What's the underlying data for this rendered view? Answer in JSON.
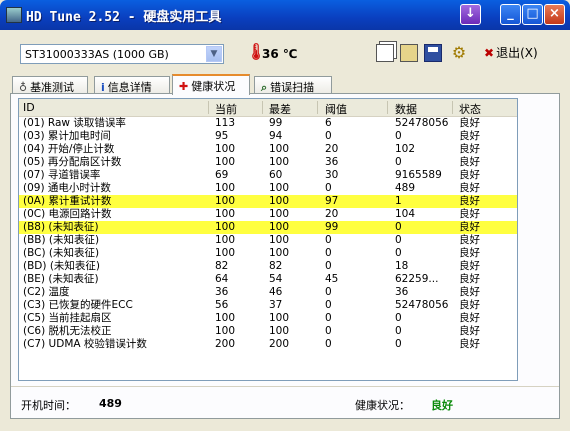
{
  "window": {
    "title": "HD Tune 2.52 - 硬盘实用工具"
  },
  "toolbar": {
    "drive": "ST31000333AS (1000 GB)",
    "temperature": "36 ℃",
    "exit_label": "退出(X)"
  },
  "tabs": [
    {
      "label": "基准测试",
      "icon": "gauge-icon"
    },
    {
      "label": "信息详情",
      "icon": "info-icon"
    },
    {
      "label": "健康状况",
      "icon": "red-cross-icon",
      "active": true
    },
    {
      "label": "错误扫描",
      "icon": "magnifier-icon"
    }
  ],
  "table": {
    "columns": [
      "ID",
      "当前",
      "最差",
      "阈值",
      "数据",
      "状态"
    ],
    "rows": [
      {
        "id": "(01) Raw 读取错误率",
        "current": "113",
        "worst": "99",
        "threshold": "6",
        "data": "52478056",
        "status": "良好",
        "highlight": false
      },
      {
        "id": "(03) 累计加电时间",
        "current": "95",
        "worst": "94",
        "threshold": "0",
        "data": "0",
        "status": "良好",
        "highlight": false
      },
      {
        "id": "(04) 开始/停止计数",
        "current": "100",
        "worst": "100",
        "threshold": "20",
        "data": "102",
        "status": "良好",
        "highlight": false
      },
      {
        "id": "(05) 再分配扇区计数",
        "current": "100",
        "worst": "100",
        "threshold": "36",
        "data": "0",
        "status": "良好",
        "highlight": false
      },
      {
        "id": "(07) 寻道错误率",
        "current": "69",
        "worst": "60",
        "threshold": "30",
        "data": "9165589",
        "status": "良好",
        "highlight": false
      },
      {
        "id": "(09) 通电小时计数",
        "current": "100",
        "worst": "100",
        "threshold": "0",
        "data": "489",
        "status": "良好",
        "highlight": false
      },
      {
        "id": "(0A) 累计重试计数",
        "current": "100",
        "worst": "100",
        "threshold": "97",
        "data": "1",
        "status": "良好",
        "highlight": true
      },
      {
        "id": "(0C) 电源回路计数",
        "current": "100",
        "worst": "100",
        "threshold": "20",
        "data": "104",
        "status": "良好",
        "highlight": false
      },
      {
        "id": "(B8) (未知表征)",
        "current": "100",
        "worst": "100",
        "threshold": "99",
        "data": "0",
        "status": "良好",
        "highlight": true
      },
      {
        "id": "(BB) (未知表征)",
        "current": "100",
        "worst": "100",
        "threshold": "0",
        "data": "0",
        "status": "良好",
        "highlight": false
      },
      {
        "id": "(BC) (未知表征)",
        "current": "100",
        "worst": "100",
        "threshold": "0",
        "data": "0",
        "status": "良好",
        "highlight": false
      },
      {
        "id": "(BD) (未知表征)",
        "current": "82",
        "worst": "82",
        "threshold": "0",
        "data": "18",
        "status": "良好",
        "highlight": false
      },
      {
        "id": "(BE) (未知表征)",
        "current": "64",
        "worst": "54",
        "threshold": "45",
        "data": "62259...",
        "status": "良好",
        "highlight": false
      },
      {
        "id": "(C2) 温度",
        "current": "36",
        "worst": "46",
        "threshold": "0",
        "data": "36",
        "status": "良好",
        "highlight": false
      },
      {
        "id": "(C3) 已恢复的硬件ECC",
        "current": "56",
        "worst": "37",
        "threshold": "0",
        "data": "52478056",
        "status": "良好",
        "highlight": false
      },
      {
        "id": "(C5) 当前挂起扇区",
        "current": "100",
        "worst": "100",
        "threshold": "0",
        "data": "0",
        "status": "良好",
        "highlight": false
      },
      {
        "id": "(C6) 脱机无法校正",
        "current": "100",
        "worst": "100",
        "threshold": "0",
        "data": "0",
        "status": "良好",
        "highlight": false
      },
      {
        "id": "(C7) UDMA 校验错误计数",
        "current": "200",
        "worst": "200",
        "threshold": "0",
        "data": "0",
        "status": "良好",
        "highlight": false
      }
    ]
  },
  "status_bar": {
    "power_on_label": "开机时间：",
    "power_on_value": "489",
    "health_label": "健康状况：",
    "health_value": "良好"
  },
  "colors": {
    "highlight": "#ffff40",
    "good": "#0a8a0a",
    "active_tab_accent": "#e68b2c"
  }
}
